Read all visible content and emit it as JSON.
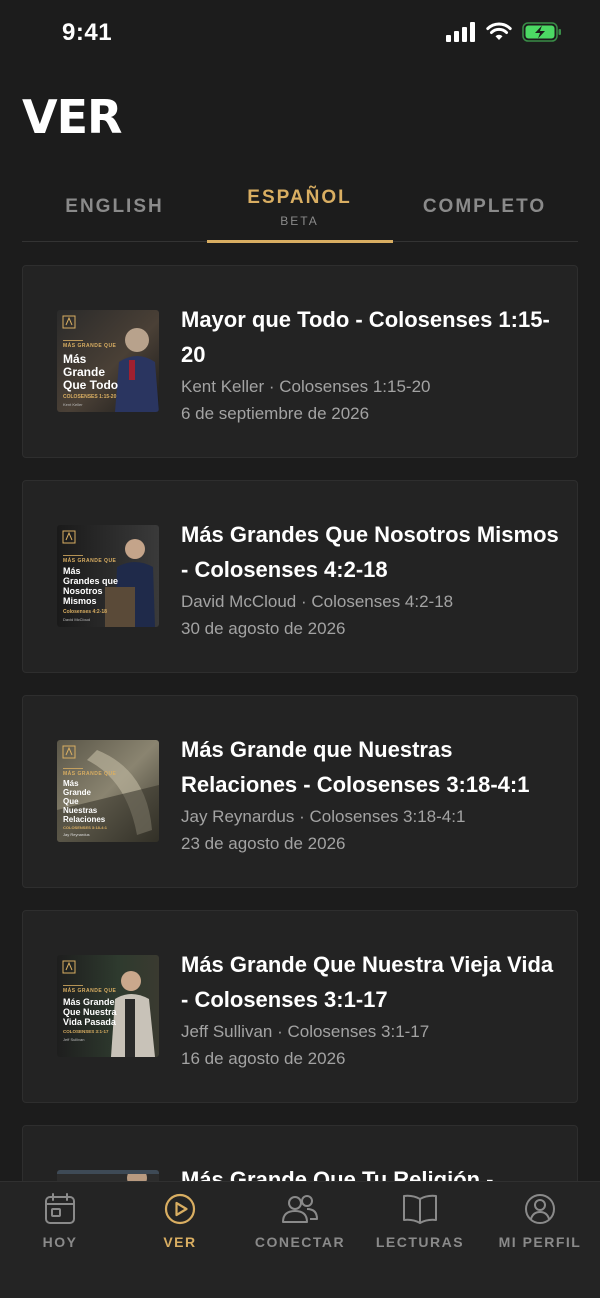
{
  "status": {
    "time": "9:41"
  },
  "header": {
    "title": "VER"
  },
  "tabs": [
    {
      "label": "ENGLISH",
      "sub": ""
    },
    {
      "label": "ESPAÑOL",
      "sub": "BETA"
    },
    {
      "label": "COMPLETO",
      "sub": ""
    }
  ],
  "colors": {
    "accent": "#d9ae62",
    "background": "#1c1c1c",
    "card": "#232323",
    "muted": "#a3a3a3",
    "battery": "#4cd964"
  },
  "sermons": [
    {
      "title": "Mayor que Todo - Colosenses 1:15-20",
      "speaker": "Kent Keller",
      "passage": "Colosenses 1:15-20",
      "separator": " · ",
      "date": "6 de septiembre de 2026",
      "thumb": {
        "series": "MÁS GRANDE QUE",
        "lines": [
          "Más",
          "Grande",
          "Que Todo"
        ],
        "passage": "COLOSENSES 1:15-20",
        "speaker": "Kent Keller"
      }
    },
    {
      "title": "Más Grandes Que Nosotros Mismos - Colosenses 4:2-18",
      "speaker": "David McCloud",
      "passage": "Colosenses 4:2-18",
      "separator": " · ",
      "date": "30 de agosto de 2026",
      "thumb": {
        "series": "MÁS GRANDE QUE",
        "lines": [
          "Más",
          "Grandes que",
          "Nosotros",
          "Mismos"
        ],
        "passage": "Colosenses 4:2-18",
        "speaker": "David McCloud"
      }
    },
    {
      "title": "Más Grande que Nuestras Relaciones - Colosenses 3:18-4:1",
      "speaker": "Jay Reynardus",
      "passage": "Colosenses 3:18-4:1",
      "separator": " · ",
      "date": "23 de agosto de 2026",
      "thumb": {
        "series": "MÁS GRANDE QUE",
        "lines": [
          "Más",
          "Grande",
          "Que",
          "Nuestras",
          "Relaciones"
        ],
        "passage": "COLOSENSES 3:18-4:1",
        "speaker": "Jay Reynardus"
      }
    },
    {
      "title": "Más Grande Que Nuestra Vieja Vida - Colosenses 3:1-17",
      "speaker": "Jeff Sullivan",
      "passage": "Colosenses 3:1-17",
      "separator": " · ",
      "date": "16 de agosto de 2026",
      "thumb": {
        "series": "MÁS GRANDE QUE",
        "lines": [
          "Más Grande",
          "Que Nuestra",
          "Vida Pasada"
        ],
        "passage": "COLOSENSES 3:1-17",
        "speaker": "Jeff Sullivan"
      }
    },
    {
      "title": "Más Grande Que Tu Religión -",
      "speaker": "",
      "passage": "",
      "separator": "",
      "date": "",
      "thumb": {
        "series": "",
        "lines": [],
        "passage": "",
        "speaker": ""
      }
    }
  ],
  "nav": [
    {
      "label": "HOY",
      "icon": "calendar-icon"
    },
    {
      "label": "VER",
      "icon": "play-circle-icon"
    },
    {
      "label": "CONECTAR",
      "icon": "people-icon"
    },
    {
      "label": "LECTURAS",
      "icon": "book-icon"
    },
    {
      "label": "MI PERFIL",
      "icon": "profile-icon"
    }
  ]
}
